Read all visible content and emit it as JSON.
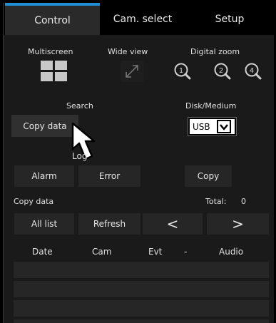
{
  "tabs": [
    {
      "label": "Control",
      "active": true
    },
    {
      "label": "Cam. select",
      "active": false
    },
    {
      "label": "Setup",
      "active": false
    }
  ],
  "view": {
    "multiscreen_label": "Multiscreen",
    "wideview_label": "Wide view",
    "digitalzoom_label": "Digital zoom",
    "zoom_levels": [
      "×1",
      "×2",
      "×4"
    ]
  },
  "search": {
    "search_label": "Search",
    "copy_data_button": "Copy data",
    "disk_medium_label": "Disk/Medium",
    "disk_selected": "USB"
  },
  "log": {
    "log_label": "Log",
    "alarm_button": "Alarm",
    "error_button": "Error",
    "copy_button": "Copy"
  },
  "copy_data": {
    "title": "Copy data",
    "total_label": "Total:",
    "total_value": "0",
    "all_list_button": "All list",
    "refresh_button": "Refresh",
    "prev_label": "<",
    "next_label": ">",
    "columns": [
      "Date",
      "Cam",
      "Evt",
      "-",
      "Audio"
    ],
    "rows": [
      "",
      "",
      "",
      ""
    ]
  },
  "colors": {
    "active_tab_accent": "#1f8fd6",
    "panel_bg": "#1a1a1a",
    "button_bg": "#262626"
  }
}
